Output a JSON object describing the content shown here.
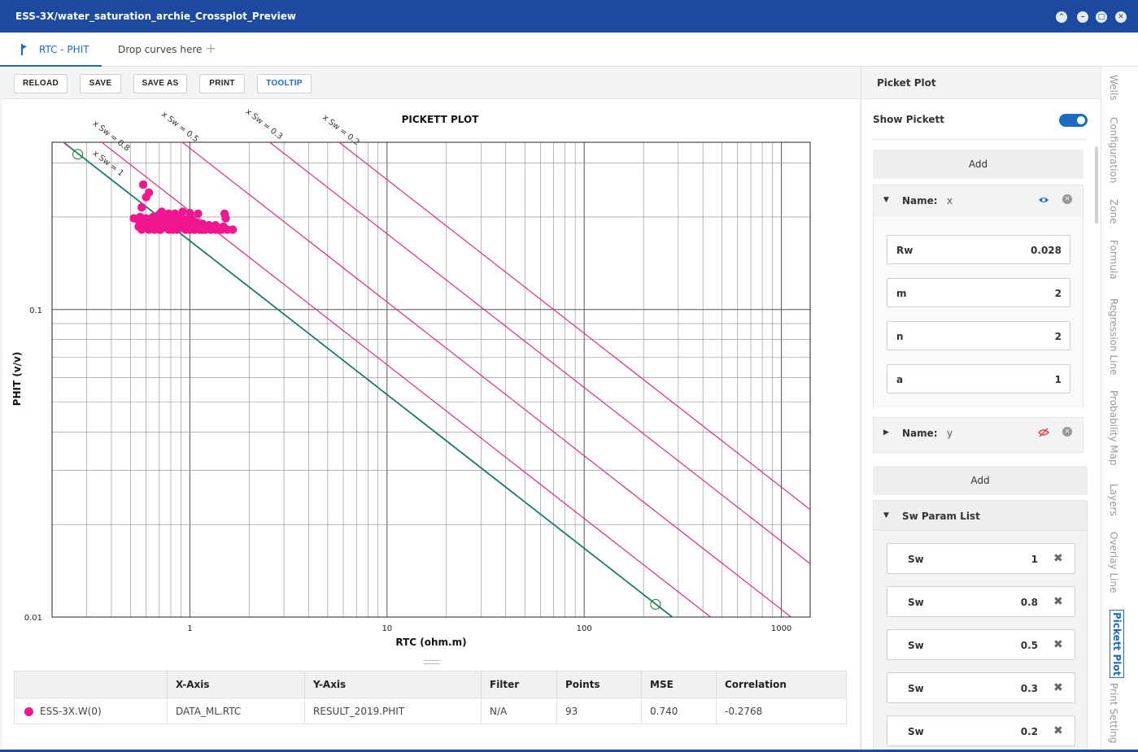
{
  "window": {
    "title": "ESS-3X/water_saturation_archie_Crossplot_Preview",
    "buttons": [
      "minimize",
      "restore-down",
      "maximize",
      "close"
    ]
  },
  "tabs": {
    "active_label": "RTC - PHIT",
    "drop_label": "Drop curves here",
    "plus": "+"
  },
  "toolbar": {
    "reload": "RELOAD",
    "save": "SAVE",
    "save_as": "SAVE AS",
    "print": "PRINT",
    "tooltip": "TOOLTIP"
  },
  "chart_data": {
    "type": "scatter",
    "title": "PICKETT PLOT",
    "xlabel": "RTC (ohm.m)",
    "ylabel": "PHIT (v/v)",
    "x_scale": "log",
    "y_scale": "log",
    "xlim": [
      0.2,
      1400
    ],
    "ylim": [
      0.01,
      0.35
    ],
    "xticks": [
      1,
      10,
      100,
      1000
    ],
    "xtick_labels": [
      "1",
      "10",
      "100",
      "1000"
    ],
    "yticks": [
      0.01,
      0.1
    ],
    "ytick_labels": [
      "0.01",
      "0.1"
    ],
    "grid": true,
    "legend": "none",
    "point_color": "#f0178e",
    "sw_line_color": "#e0197f",
    "sw1_line_color": "#1b7a6e",
    "rw": 0.028,
    "m": 2,
    "n": 2,
    "a": 1,
    "sw_lines": [
      {
        "sw": 1,
        "label": "x Sw = 1"
      },
      {
        "sw": 0.8,
        "label": "x Sw = 0.8"
      },
      {
        "sw": 0.5,
        "label": "x Sw = 0.5"
      },
      {
        "sw": 0.3,
        "label": "x Sw = 0.3"
      },
      {
        "sw": 0.2,
        "label": "x Sw = 0.2"
      }
    ],
    "handles": [
      {
        "x": 0.27,
        "y": 0.32
      },
      {
        "x": 230,
        "y": 0.011
      }
    ],
    "series": [
      {
        "x": [
          0.58,
          0.6,
          0.62,
          0.57,
          0.59,
          0.64,
          0.66,
          0.7,
          0.74,
          0.78,
          0.82,
          0.86,
          0.9,
          0.95,
          1.0,
          1.05,
          1.12,
          1.2,
          1.28,
          1.35,
          1.45,
          1.55,
          1.65,
          0.52,
          0.55,
          0.58,
          0.62,
          0.66,
          0.7,
          0.75,
          0.8,
          0.85,
          0.9,
          0.96,
          1.02,
          1.1,
          1.18,
          1.26,
          1.36,
          1.48,
          0.56,
          0.6,
          0.65,
          0.7,
          0.76,
          0.82,
          0.88,
          0.94,
          1.0,
          1.08,
          1.16,
          1.25,
          1.35,
          0.72,
          0.78,
          0.84,
          0.92,
          1.0,
          1.1,
          1.5,
          0.55,
          0.6,
          0.63,
          0.68,
          0.73,
          0.8,
          0.87,
          0.93,
          0.98,
          1.04,
          1.14,
          1.22,
          1.32,
          1.42,
          0.57,
          0.62,
          0.66,
          0.71,
          0.77,
          0.83,
          0.89,
          0.97,
          1.06,
          1.16,
          1.28,
          1.4,
          0.69,
          0.79,
          0.86,
          0.95,
          1.03,
          1.52
        ],
        "y": [
          0.255,
          0.232,
          0.24,
          0.215,
          0.19,
          0.185,
          0.182,
          0.182,
          0.185,
          0.182,
          0.182,
          0.182,
          0.185,
          0.182,
          0.182,
          0.182,
          0.182,
          0.182,
          0.182,
          0.182,
          0.182,
          0.182,
          0.182,
          0.198,
          0.195,
          0.195,
          0.192,
          0.192,
          0.195,
          0.192,
          0.19,
          0.192,
          0.19,
          0.19,
          0.188,
          0.186,
          0.186,
          0.186,
          0.186,
          0.186,
          0.2,
          0.198,
          0.2,
          0.204,
          0.2,
          0.202,
          0.198,
          0.196,
          0.194,
          0.192,
          0.19,
          0.188,
          0.188,
          0.208,
          0.205,
          0.205,
          0.208,
          0.206,
          0.205,
          0.205,
          0.186,
          0.184,
          0.188,
          0.186,
          0.19,
          0.186,
          0.188,
          0.186,
          0.188,
          0.184,
          0.184,
          0.184,
          0.184,
          0.184,
          0.182,
          0.182,
          0.184,
          0.182,
          0.184,
          0.184,
          0.184,
          0.184,
          0.182,
          0.182,
          0.182,
          0.182,
          0.196,
          0.196,
          0.196,
          0.196,
          0.196,
          0.198
        ]
      }
    ]
  },
  "table": {
    "headers": [
      "",
      "X-Axis",
      "Y-Axis",
      "Filter",
      "Points",
      "MSE",
      "Correlation"
    ],
    "rows": [
      {
        "name": "ESS-3X.W(0)",
        "x_axis": "DATA_ML.RTC",
        "y_axis": "RESULT_2019.PHIT",
        "filter": "N/A",
        "points": "93",
        "mse": "0.740",
        "correlation": "-0.2768",
        "color": "#f0178e"
      }
    ]
  },
  "panel": {
    "title": "Picket Plot",
    "show_pickett": "Show Pickett",
    "add1": "Add",
    "add2": "Add",
    "name_label": "Name:",
    "name_x": "x",
    "name_y": "y",
    "params": [
      {
        "label": "Rw",
        "value": "0.028"
      },
      {
        "label": "m",
        "value": "2"
      },
      {
        "label": "n",
        "value": "2"
      },
      {
        "label": "a",
        "value": "1"
      }
    ],
    "sw_title": "Sw Param List",
    "sw_list": [
      {
        "label": "Sw",
        "value": "1"
      },
      {
        "label": "Sw",
        "value": "0.8"
      },
      {
        "label": "Sw",
        "value": "0.5"
      },
      {
        "label": "Sw",
        "value": "0.3"
      },
      {
        "label": "Sw",
        "value": "0.2"
      }
    ],
    "remove_glyph": "✖"
  },
  "side_tabs": [
    "Wells",
    "Configuration",
    "Zone",
    "Formula",
    "Regression Line",
    "Probability Map",
    "Layers",
    "Overlay Line",
    "Pickett Plot",
    "Print Setting"
  ],
  "side_tab_active": "Pickett Plot"
}
